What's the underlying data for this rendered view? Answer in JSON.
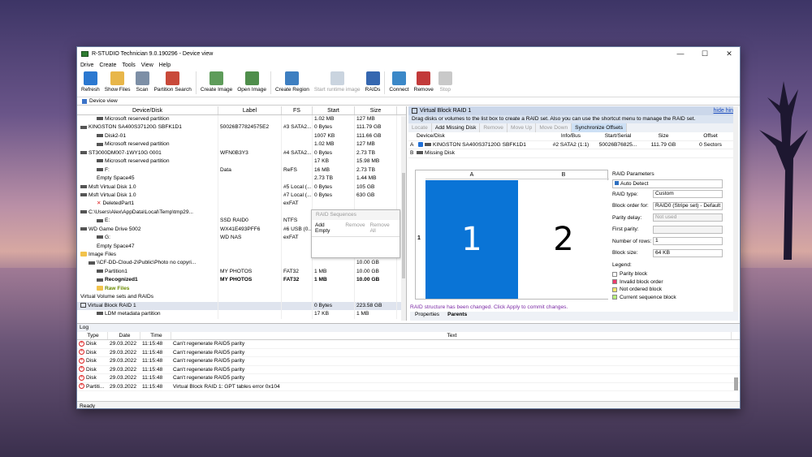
{
  "window": {
    "title": "R-STUDIO Technician 9.0.190296 - Device view"
  },
  "menu": [
    "Drive",
    "Create",
    "Tools",
    "View",
    "Help"
  ],
  "toolbar": [
    {
      "label": "Refresh",
      "icon": "refresh-icon",
      "enabled": true
    },
    {
      "label": "Show Files",
      "icon": "show-files-icon",
      "enabled": true
    },
    {
      "label": "Scan",
      "icon": "scan-icon",
      "enabled": true
    },
    {
      "label": "Partition Search",
      "icon": "partition-search-icon",
      "enabled": true
    },
    {
      "label": "Create Image",
      "icon": "create-image-icon",
      "enabled": true
    },
    {
      "label": "Open Image",
      "icon": "open-image-icon",
      "enabled": true
    },
    {
      "label": "Create Region",
      "icon": "create-region-icon",
      "enabled": true
    },
    {
      "label": "Start runtime image",
      "icon": "runtime-image-icon",
      "enabled": false
    },
    {
      "label": "RAIDs",
      "icon": "raids-icon",
      "enabled": true
    },
    {
      "label": "Connect",
      "icon": "connect-icon",
      "enabled": true
    },
    {
      "label": "Remove",
      "icon": "remove-icon",
      "enabled": true
    },
    {
      "label": "Stop",
      "icon": "stop-icon",
      "enabled": false
    }
  ],
  "view_label": "Device view",
  "device_table": {
    "columns": [
      "Device/Disk",
      "Label",
      "FS",
      "Start",
      "Size"
    ],
    "rows": [
      {
        "name": "Microsoft reserved partition",
        "label": "",
        "fs": "",
        "start": "1.02 MB",
        "size": "127 MB",
        "indent": 2,
        "icon": "disk"
      },
      {
        "name": "KINGSTON SA400S37120G SBFK1D1",
        "label": "50026B77824575E2",
        "fs": "#3 SATA2...",
        "start": "0 Bytes",
        "size": "111.79 GB",
        "indent": 0,
        "icon": "disk"
      },
      {
        "name": "Disk2-01",
        "label": "",
        "fs": "",
        "start": "1007 KB",
        "size": "111.66 GB",
        "indent": 2,
        "icon": "disk"
      },
      {
        "name": "Microsoft reserved partition",
        "label": "",
        "fs": "",
        "start": "1.02 MB",
        "size": "127 MB",
        "indent": 2,
        "icon": "disk"
      },
      {
        "name": "ST3000DM007-1WY10G 0001",
        "label": "WFN0B3Y3",
        "fs": "#4 SATA2...",
        "start": "0 Bytes",
        "size": "2.73 TB",
        "indent": 0,
        "icon": "disk"
      },
      {
        "name": "Microsoft reserved partition",
        "label": "",
        "fs": "",
        "start": "17 KB",
        "size": "15.98 MB",
        "indent": 2,
        "icon": "disk"
      },
      {
        "name": "F:",
        "label": "Data",
        "fs": "ReFS",
        "start": "16 MB",
        "size": "2.73 TB",
        "indent": 2,
        "icon": "disk"
      },
      {
        "name": "Empty Space45",
        "label": "",
        "fs": "",
        "start": "2.73 TB",
        "size": "1.44 MB",
        "indent": 2,
        "icon": "none"
      },
      {
        "name": "Msft Virtual Disk 1.0",
        "label": "",
        "fs": "#5 Local (...",
        "start": "0 Bytes",
        "size": "105 GB",
        "indent": 0,
        "icon": "disk"
      },
      {
        "name": "Msft Virtual Disk 1.0",
        "label": "",
        "fs": "#7 Local (...",
        "start": "0 Bytes",
        "size": "630 GB",
        "indent": 0,
        "icon": "disk"
      },
      {
        "name": "DeletedPart1",
        "label": "",
        "fs": "exFAT",
        "start": "",
        "size": "",
        "indent": 2,
        "icon": "x"
      },
      {
        "name": "C:\\Users\\Alex\\AppData\\Local\\Temp\\tmp29...",
        "label": "",
        "fs": "",
        "start": "",
        "size": "",
        "indent": 0,
        "icon": "disk"
      },
      {
        "name": "E:",
        "label": "SSD RAID0",
        "fs": "NTFS",
        "start": "",
        "size": "",
        "indent": 2,
        "icon": "disk"
      },
      {
        "name": "WD Game Drive 5002",
        "label": "WX41E493PFF6",
        "fs": "#6 USB (0...",
        "start": "",
        "size": "",
        "indent": 0,
        "icon": "disk"
      },
      {
        "name": "G:",
        "label": "WD NAS",
        "fs": "exFAT",
        "start": "",
        "size": "",
        "indent": 2,
        "icon": "disk"
      },
      {
        "name": "Empty Space47",
        "label": "",
        "fs": "",
        "start": "",
        "size": "",
        "indent": 2,
        "icon": "none"
      },
      {
        "name": "Image Files",
        "label": "",
        "fs": "",
        "start": "",
        "size": "",
        "indent": 0,
        "icon": "folder"
      },
      {
        "name": "\\\\CF-DD-Cloud-2\\Public\\Photo no copyri...",
        "label": "",
        "fs": "",
        "start": "",
        "size": "10.00 GB",
        "indent": 1,
        "icon": "disk"
      },
      {
        "name": "Partition1",
        "label": "MY PHOTOS",
        "fs": "FAT32",
        "start": "1 MB",
        "size": "10.00 GB",
        "indent": 2,
        "icon": "disk"
      },
      {
        "name": "Recognized1",
        "label": "MY PHOTOS",
        "fs": "FAT32",
        "start": "1 MB",
        "size": "10.00 GB",
        "indent": 2,
        "icon": "disk",
        "bold": true
      },
      {
        "name": "Raw Files",
        "label": "",
        "fs": "",
        "start": "",
        "size": "",
        "indent": 2,
        "icon": "folder",
        "bold": true,
        "color": "#6a8a00"
      },
      {
        "name": "Virtual Volume sets and RAIDs",
        "label": "",
        "fs": "",
        "start": "",
        "size": "",
        "indent": 0,
        "icon": "none"
      },
      {
        "name": "Virtual Block RAID 1",
        "label": "",
        "fs": "",
        "start": "0 Bytes",
        "size": "223.58 GB",
        "indent": 0,
        "icon": "raid",
        "selected": true
      },
      {
        "name": "LDM metadata partition",
        "label": "",
        "fs": "",
        "start": "17 KB",
        "size": "1 MB",
        "indent": 2,
        "icon": "disk"
      }
    ]
  },
  "popup": {
    "title": "RAID Sequences",
    "add": "Add Empty",
    "remove": "Remove",
    "remove_all": "Remove All"
  },
  "raid": {
    "title": "Virtual Block RAID 1",
    "hide": "hide hint",
    "hint": "Drag disks or volumes to the list box to create a RAID set. Also you can use the shortcut menu to manage the RAID set.",
    "tools": [
      "Locate",
      "Add Missing Disk",
      "Remove",
      "Move Up",
      "Move Down",
      "Synchronize Offsets"
    ],
    "members_head": [
      "",
      "Device/Disk",
      "Info/Bus",
      "Start/Serial",
      "Size",
      "Offset"
    ],
    "members": [
      {
        "id": "A",
        "disk": "KINGSTON SA400S37120G SBFK1D1",
        "bus": "#2 SATA2 (1:1)",
        "serial": "50026B76825...",
        "size": "111.79 GB",
        "offset": "0 Sectors"
      },
      {
        "id": "B",
        "disk": "Missing Disk",
        "bus": "",
        "serial": "",
        "size": "",
        "offset": ""
      }
    ],
    "col_a": "A",
    "col_b": "B",
    "row": "1",
    "cell_a": "1",
    "cell_b": "2",
    "status": "RAID structure has been changed. Click Apply to commit changes.",
    "tabs": [
      "Properties",
      "Parents"
    ]
  },
  "params": {
    "title": "RAID Parameters",
    "auto": "Auto Detect",
    "fields": [
      {
        "label": "RAID type:",
        "value": "Custom",
        "enabled": true
      },
      {
        "label": "Block order for:",
        "value": "RAID0 (Stripe set) - Default",
        "enabled": true
      },
      {
        "label": "Parity delay:",
        "value": "Not used",
        "enabled": false
      },
      {
        "label": "First parity:",
        "value": "",
        "enabled": false
      },
      {
        "label": "Number of rows:",
        "value": "1",
        "enabled": true
      },
      {
        "label": "Block size:",
        "value": "64 KB",
        "enabled": true
      }
    ],
    "legend_title": "Legend:",
    "legend": [
      {
        "label": "Parity block",
        "color": "#ffffff"
      },
      {
        "label": "Invalid block order",
        "color": "#ef3b6d"
      },
      {
        "label": "Not ordered block",
        "color": "#f7e96b"
      },
      {
        "label": "Current sequence block",
        "color": "#b7f07a"
      }
    ]
  },
  "log": {
    "title": "Log",
    "head": [
      "Type",
      "Date",
      "Time",
      "Text"
    ],
    "rows": [
      {
        "type": "Disk",
        "date": "29.03.2022",
        "time": "11:15:48",
        "text": "Can't regenerate RAID5 parity"
      },
      {
        "type": "Disk",
        "date": "29.03.2022",
        "time": "11:15:48",
        "text": "Can't regenerate RAID5 parity"
      },
      {
        "type": "Disk",
        "date": "29.03.2022",
        "time": "11:15:48",
        "text": "Can't regenerate RAID5 parity"
      },
      {
        "type": "Disk",
        "date": "29.03.2022",
        "time": "11:15:48",
        "text": "Can't regenerate RAID5 parity"
      },
      {
        "type": "Disk",
        "date": "29.03.2022",
        "time": "11:15:48",
        "text": "Can't regenerate RAID5 parity"
      },
      {
        "type": "Partiti...",
        "date": "29.03.2022",
        "time": "11:15:48",
        "text": "Virtual Block RAID 1: GPT tables error 0x104"
      }
    ]
  },
  "statusbar": "Ready"
}
